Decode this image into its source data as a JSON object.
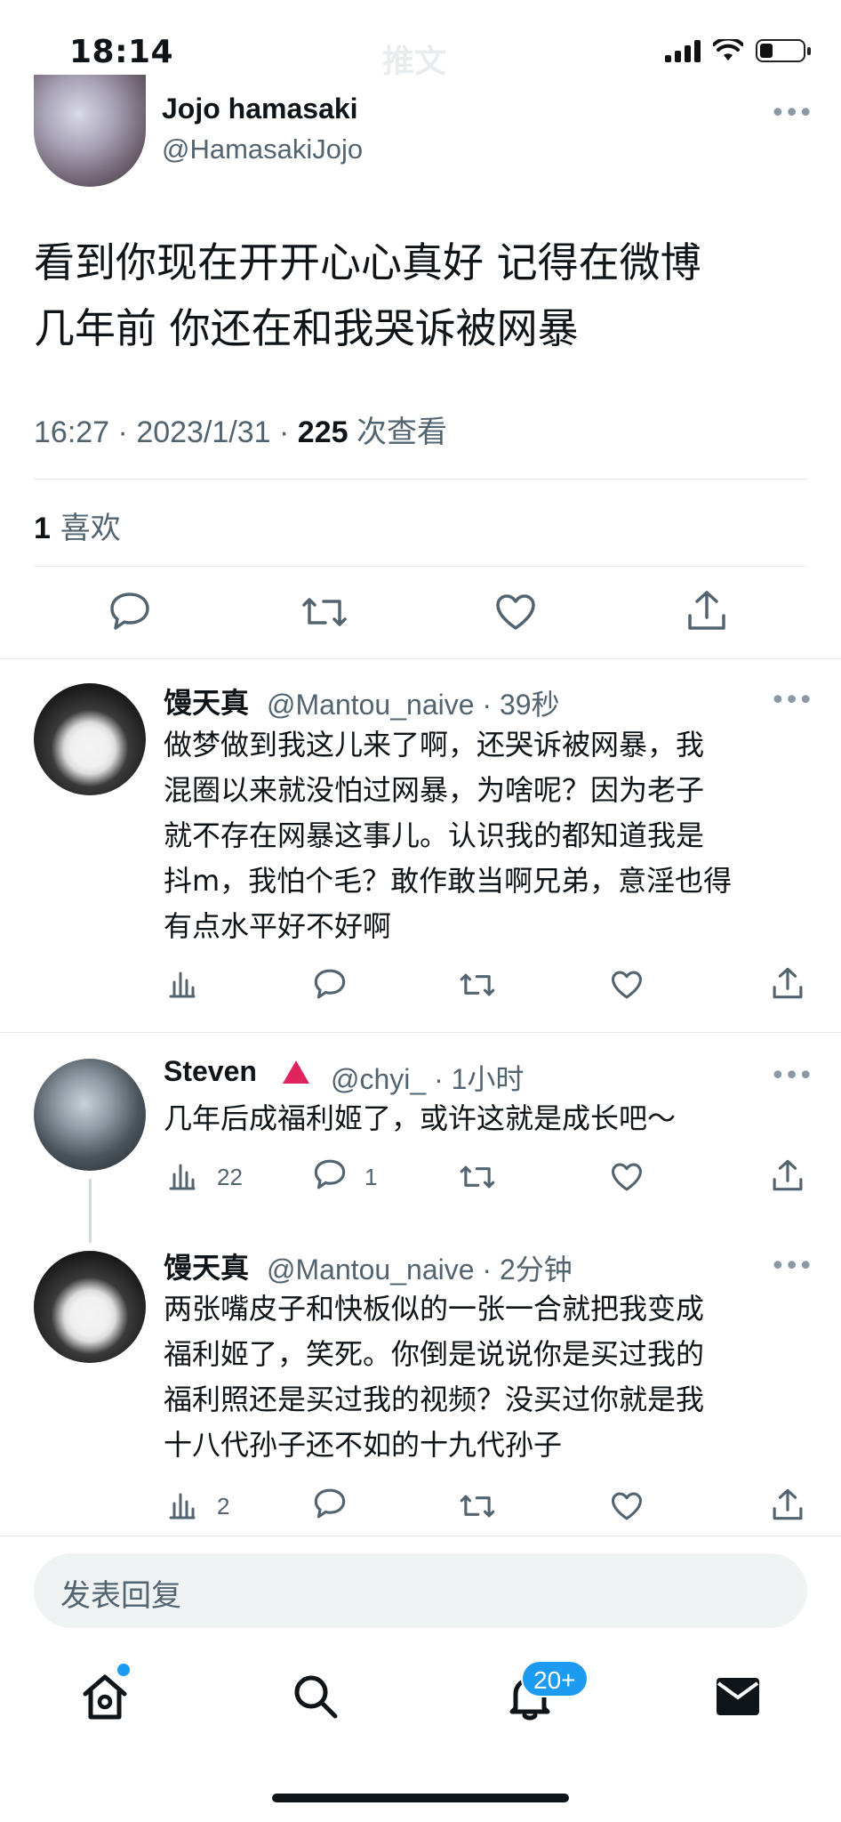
{
  "status_bar": {
    "time": "18:14",
    "faded_title": "推文"
  },
  "tweet": {
    "author_name": "Jojo hamasaki",
    "author_handle": "@HamasakiJojo",
    "text_line1": "看到你现在开开心心真好 记得在微博",
    "text_line2": "几年前 你还在和我哭诉被网暴",
    "time": "16:27",
    "sep": " · ",
    "date": "2023/1/31",
    "views_count": "225",
    "views_label": " 次查看",
    "likes_count": "1",
    "likes_label": " 喜欢"
  },
  "replies": [
    {
      "name": "馒天真",
      "handle": "@Mantou_naive · 39秒",
      "lines": [
        "做梦做到我这儿来了啊，还哭诉被网暴，我",
        "混圈以来就没怕过网暴，为啥呢？因为老子",
        "就不存在网暴这事儿。认识我的都知道我是",
        "抖m，我怕个毛？敢作敢当啊兄弟，意淫也得",
        "有点水平好不好啊"
      ]
    },
    {
      "name": "Steven",
      "handle": "@chyi_ · 1小时",
      "lines": [
        "几年后成福利姬了，或许这就是成长吧～"
      ],
      "views": "22",
      "replies_count": "1"
    },
    {
      "name": "馒天真",
      "handle": "@Mantou_naive · 2分钟",
      "lines": [
        "两张嘴皮子和快板似的一张一合就把我变成",
        "福利姬了，笑死。你倒是说说你是买过我的",
        "福利照还是买过我的视频？没买过你就是我",
        "十八代孙子还不如的十九代孙子"
      ],
      "views": "2"
    }
  ],
  "reply_box": {
    "placeholder": "发表回复"
  },
  "tabbar": {
    "notifications_badge": "20+"
  },
  "colors": {
    "accent": "#1d9bf0",
    "secondary_text": "#536471",
    "warning": "#e0245e"
  },
  "icons": [
    "home-icon",
    "search-icon",
    "bell-icon",
    "mail-icon",
    "reply-icon",
    "retweet-icon",
    "like-icon",
    "share-icon",
    "views-icon",
    "more-icon"
  ]
}
